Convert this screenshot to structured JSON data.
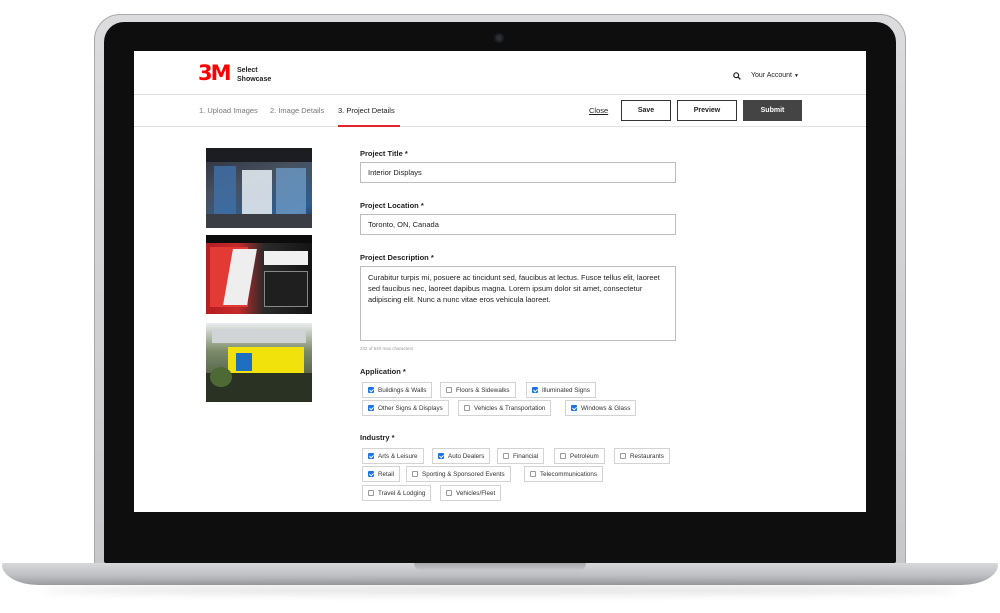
{
  "header": {
    "logo": "3M",
    "brand_line1": "Select",
    "brand_line2": "Showcase",
    "account_label": "Your Account"
  },
  "steps": [
    {
      "label": "1. Upload Images",
      "active": false
    },
    {
      "label": "2. Image Details",
      "active": false
    },
    {
      "label": "3. Project Details",
      "active": true
    }
  ],
  "actions": {
    "close": "Close",
    "save": "Save",
    "preview": "Preview",
    "submit": "Submit"
  },
  "form": {
    "title_label": "Project Title *",
    "title_value": "Interior Displays",
    "location_label": "Project Location *",
    "location_value": "Toronto, ON, Canada",
    "description_label": "Project Description *",
    "description_value": "Curabitur turpis mi, posuere ac tincidunt sed, faucibus at lectus. Fusce tellus elit, laoreet sed faucibus nec, laoreet dapibus magna. Lorem ipsum dolor sit amet, consectetur adipiscing elit. Nunc a nunc vitae eros vehicula laoreet.",
    "char_count": "232 of 540 max characters",
    "application_label": "Application *",
    "application_options": [
      {
        "label": "Buildings & Walls",
        "checked": true
      },
      {
        "label": "Floors & Sidewalks",
        "checked": false
      },
      {
        "label": "Illuminated Signs",
        "checked": true
      },
      {
        "label": "Other Signs & Displays",
        "checked": true
      },
      {
        "label": "Vehicles & Transportation",
        "checked": false
      },
      {
        "label": "Windows & Glass",
        "checked": true
      }
    ],
    "industry_label": "Industry *",
    "industry_options": [
      {
        "label": "Arts & Leisure",
        "checked": true
      },
      {
        "label": "Auto Dealers",
        "checked": true
      },
      {
        "label": "Financial",
        "checked": false
      },
      {
        "label": "Petroleum",
        "checked": false
      },
      {
        "label": "Restaurants",
        "checked": false
      },
      {
        "label": "Retail",
        "checked": true
      },
      {
        "label": "Sporting & Sponsored Events",
        "checked": false
      },
      {
        "label": "Telecommunications",
        "checked": false
      },
      {
        "label": "Travel & Lodging",
        "checked": false
      },
      {
        "label": "Vehicles/Fleet",
        "checked": false
      }
    ]
  },
  "colors": {
    "brand_red": "#ff0000",
    "active_underline": "#e8242b",
    "checkbox_blue": "#1a73e8",
    "submit_bg": "#444444"
  }
}
